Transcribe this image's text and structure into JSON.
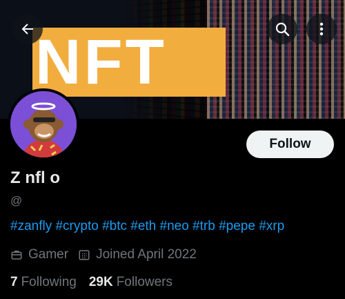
{
  "banner": {
    "text": "NFT",
    "accent": "#f2ad3f"
  },
  "header": {
    "back_icon": "arrow-left-icon",
    "search_icon": "search-icon",
    "more_icon": "more-vertical-icon"
  },
  "profile": {
    "display_name": "Z nfl  o",
    "handle": "@",
    "bio": "#zanfly #crypto #btc #eth #neo #trb #pepe #xrp",
    "category": "Gamer",
    "joined": "Joined April 2022",
    "following_count": "7",
    "following_label": "Following",
    "followers_count": "29K",
    "followers_label": "Followers"
  },
  "actions": {
    "follow_label": "Follow"
  },
  "colors": {
    "link": "#1d9bf0",
    "muted": "#71767b",
    "avatar_bg": "#7b4fd6"
  }
}
